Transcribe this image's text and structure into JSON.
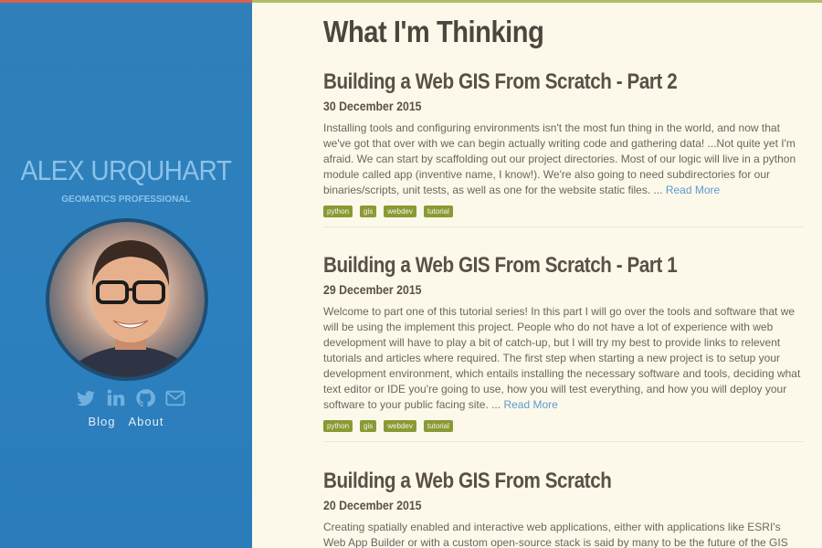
{
  "sidebar": {
    "name": "ALEX URQUHART",
    "subtitle": "GEOMATICS PROFESSIONAL",
    "social_icons": [
      "twitter-icon",
      "linkedin-icon",
      "github-icon",
      "email-icon"
    ],
    "nav": [
      {
        "label": "Blog"
      },
      {
        "label": "About"
      }
    ]
  },
  "main": {
    "title": "What I'm Thinking",
    "posts": [
      {
        "title": "Building a Web GIS From Scratch - Part 2",
        "date": "30 December 2015",
        "excerpt": "Installing tools and configuring environments isn't the most fun thing in the world, and now that we've got that over with we can begin actually writing code and gathering data! ...Not quite yet I'm afraid. We can start by scaffolding out our project directories. Most of our logic will live in a python module called app (inventive name, I know!). We're also going to need subdirectories for our binaries/scripts, unit tests, as well as one for the website static files. ...",
        "read_more": "Read More",
        "tags": [
          "python",
          "gis",
          "webdev",
          "tutorial"
        ]
      },
      {
        "title": "Building a Web GIS From Scratch - Part 1",
        "date": "29 December 2015",
        "excerpt": "Welcome to part one of this tutorial series! In this part I will go over the tools and software that we will be using the implement this project. People who do not have a lot of experience with web development will have to play a bit of catch-up, but I will try my best to provide links to relevent tutorials and articles where required. The first step when starting a new project is to setup your development environment, which entails installing the necessary software and tools, deciding what text editor or IDE you're going to use, how you will test everything, and how you will deploy your software to your public facing site. ...",
        "read_more": "Read More",
        "tags": [
          "python",
          "gis",
          "webdev",
          "tutorial"
        ]
      },
      {
        "title": "Building a Web GIS From Scratch",
        "date": "20 December 2015",
        "excerpt": "Creating spatially enabled and interactive web applications, either with applications like ESRI's Web App Builder or with a custom open-source stack is said by many to be the future of the GIS and"
      }
    ]
  },
  "colors": {
    "sidebar": "#2d80be",
    "page": "#fdf9ea",
    "tag": "#8a9a34",
    "link": "#5b9bd1",
    "top_accent_sidebar": "#d8604c",
    "top_accent_main": "#aebd68"
  }
}
